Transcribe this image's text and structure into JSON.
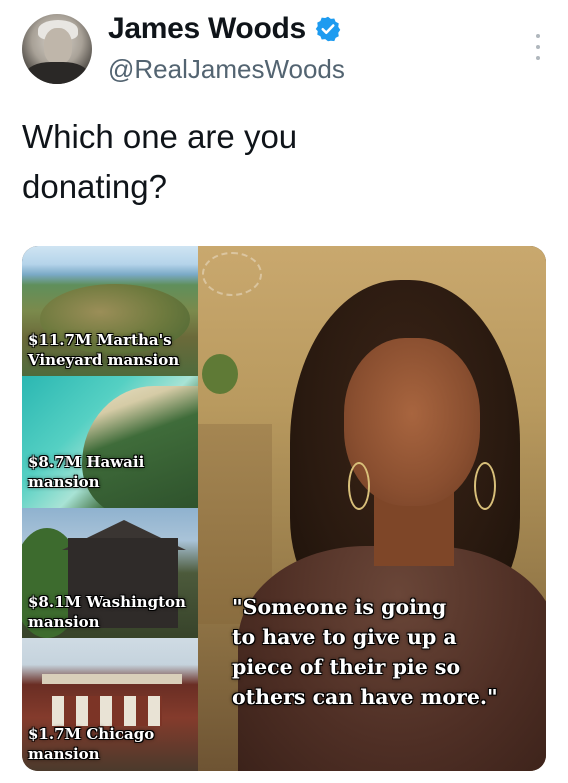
{
  "author": {
    "display_name": "James Woods",
    "handle": "@RealJamesWoods",
    "verified": true,
    "verified_color": "#1d9bf0"
  },
  "tweet": {
    "text": "Which one are you\ndonating?"
  },
  "media": {
    "house_labels": [
      "$11.7M Martha's\nVineyard mansion",
      "$8.7M Hawaii\nmansion",
      "$8.1M Washington\nmansion",
      "$1.7M Chicago\nmansion"
    ],
    "quote": "\"Someone is going\nto have to give up a\npiece of their pie so\nothers can have more.\""
  },
  "icons": {
    "avatar": "profile-photo",
    "verified": "verified-badge-icon",
    "more": "more-options-icon"
  }
}
